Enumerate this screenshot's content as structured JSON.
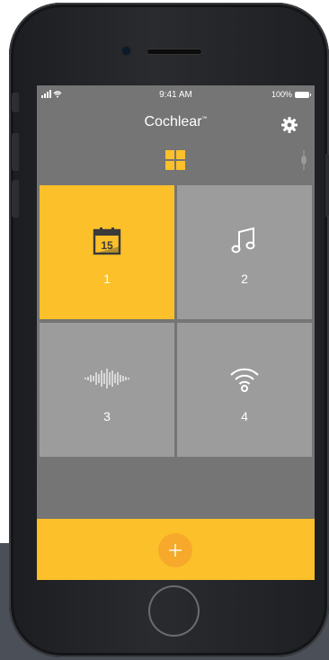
{
  "status_bar": {
    "signal": "∙∙∙∙",
    "time": "9:41 AM",
    "battery_text": "100%"
  },
  "header": {
    "title": "Cochlear",
    "trademark": "™",
    "settings_icon": "gear-icon",
    "view_icon": "grid-view-icon"
  },
  "tiles": [
    {
      "label": "1",
      "icon": "calendar-icon",
      "active": true
    },
    {
      "label": "2",
      "icon": "music-note-icon",
      "active": false
    },
    {
      "label": "3",
      "icon": "waveform-icon",
      "active": false
    },
    {
      "label": "4",
      "icon": "wifi-icon",
      "active": false
    }
  ],
  "calendar_day": "15",
  "add_button": {
    "icon": "plus-icon"
  },
  "colors": {
    "accent": "#fbc02a",
    "add_button": "#f6a92a",
    "tile": "#9c9c9c",
    "screen_bg": "#757575"
  }
}
